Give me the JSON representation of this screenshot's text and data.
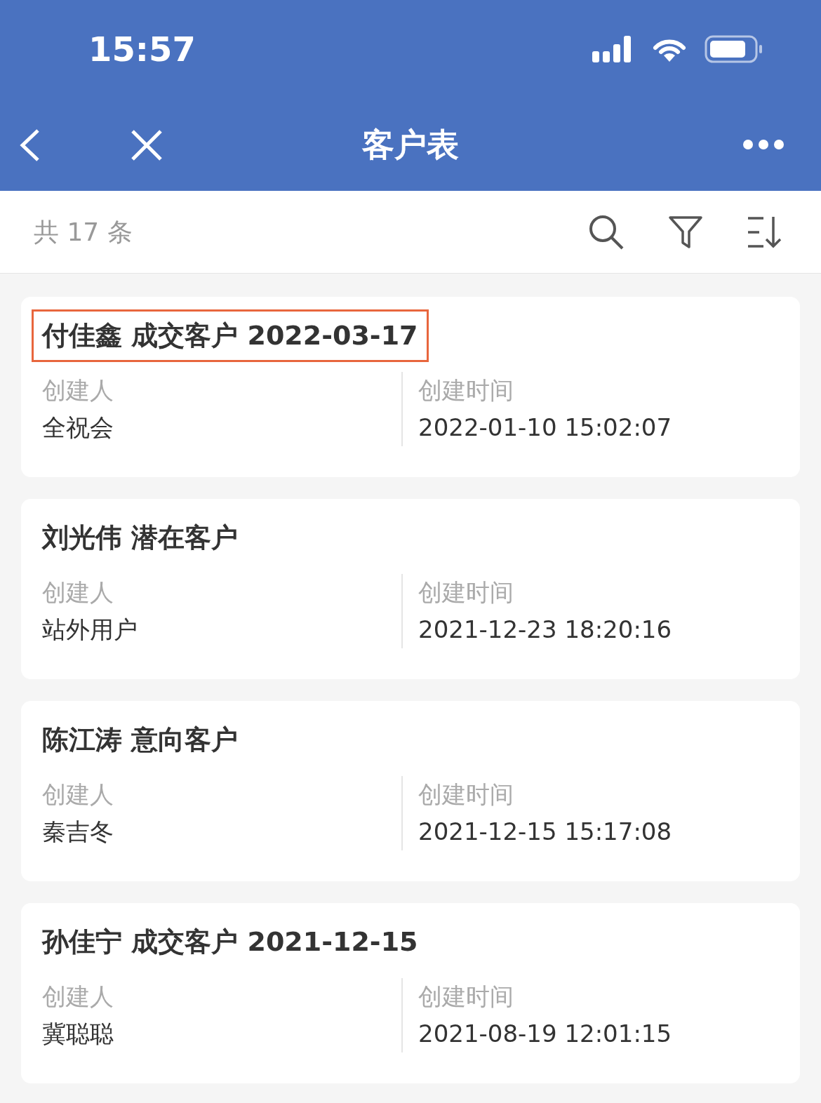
{
  "status_bar": {
    "time": "15:57"
  },
  "nav_bar": {
    "title": "客户表"
  },
  "toolbar": {
    "count": "共 17 条"
  },
  "records": [
    {
      "title": "付佳鑫 成交客户 2022-03-17",
      "highlighted": true,
      "fields": [
        {
          "label": "创建人",
          "value": "全祝会"
        },
        {
          "label": "创建时间",
          "value": "2022-01-10 15:02:07"
        }
      ]
    },
    {
      "title": "刘光伟 潜在客户",
      "highlighted": false,
      "fields": [
        {
          "label": "创建人",
          "value": "站外用户"
        },
        {
          "label": "创建时间",
          "value": "2021-12-23 18:20:16"
        }
      ]
    },
    {
      "title": "陈江涛 意向客户",
      "highlighted": false,
      "fields": [
        {
          "label": "创建人",
          "value": "秦吉冬"
        },
        {
          "label": "创建时间",
          "value": "2021-12-15 15:17:08"
        }
      ]
    },
    {
      "title": "孙佳宁 成交客户 2021-12-15",
      "highlighted": false,
      "fields": [
        {
          "label": "创建人",
          "value": "冀聪聪"
        },
        {
          "label": "创建时间",
          "value": "2021-08-19 12:01:15"
        }
      ]
    }
  ]
}
